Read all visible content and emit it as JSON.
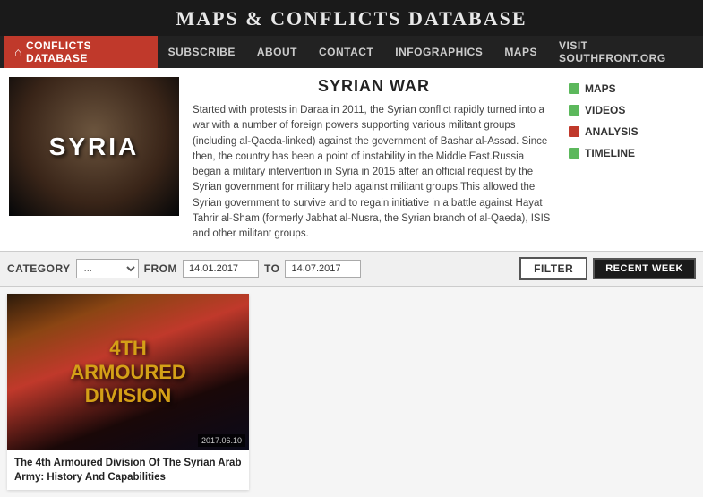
{
  "site": {
    "title": "MAPS & CONFLICTS DATABASE"
  },
  "nav": {
    "items": [
      {
        "id": "conflicts-db",
        "label": "CONFLICTS DATABASE",
        "active": true,
        "has_home_icon": true
      },
      {
        "id": "subscribe",
        "label": "SUBSCRIBE",
        "active": false
      },
      {
        "id": "about",
        "label": "ABOUT",
        "active": false
      },
      {
        "id": "contact",
        "label": "CONTACT",
        "active": false
      },
      {
        "id": "infographics",
        "label": "INFOGRAPHICS",
        "active": false
      },
      {
        "id": "maps",
        "label": "MAPS",
        "active": false
      },
      {
        "id": "visit-southfront",
        "label": "VISIT SOUTHFRONT.ORG",
        "active": false
      }
    ]
  },
  "article": {
    "title": "SYRIAN WAR",
    "body": "Started with protests in Daraa in 2011, the Syrian conflict rapidly turned into a war with a number of foreign powers supporting various militant groups (including al-Qaeda-linked) against the government of Bashar al-Assad. Since then, the country has been a point of instability in the Middle East.Russia began a military intervention in Syria in 2015 after an official request by the Syrian government for military help against militant groups.This allowed the Syrian government to survive and to regain initiative in a battle against Hayat Tahrir al-Sham (formerly Jabhat al-Nusra, the Syrian branch of al-Qaeda), ISIS and other militant groups.",
    "image_label": "SYRIA",
    "sidebar_links": [
      {
        "id": "maps",
        "label": "MAPS",
        "color": "green"
      },
      {
        "id": "videos",
        "label": "VIDEOS",
        "color": "green"
      },
      {
        "id": "analysis",
        "label": "ANALYSIS",
        "color": "red"
      },
      {
        "id": "timeline",
        "label": "TIMELINE",
        "color": "green"
      }
    ]
  },
  "filter": {
    "category_label": "CATEGORY",
    "category_value": "...",
    "from_label": "FROM",
    "to_label": "TO",
    "from_date": "14.01.2017",
    "to_date": "14.07.2017",
    "filter_btn": "FILTER",
    "recent_week_btn": "RECENT WEEK"
  },
  "cards": [
    {
      "id": "card-1",
      "image_title_line1": "4TH",
      "image_title_line2": "ARMOURED",
      "image_title_line3": "DIVISION",
      "date_badge": "2017.06.10",
      "caption": "The 4th Armoured Division Of The Syrian Arab Army: History And Capabilities"
    }
  ]
}
